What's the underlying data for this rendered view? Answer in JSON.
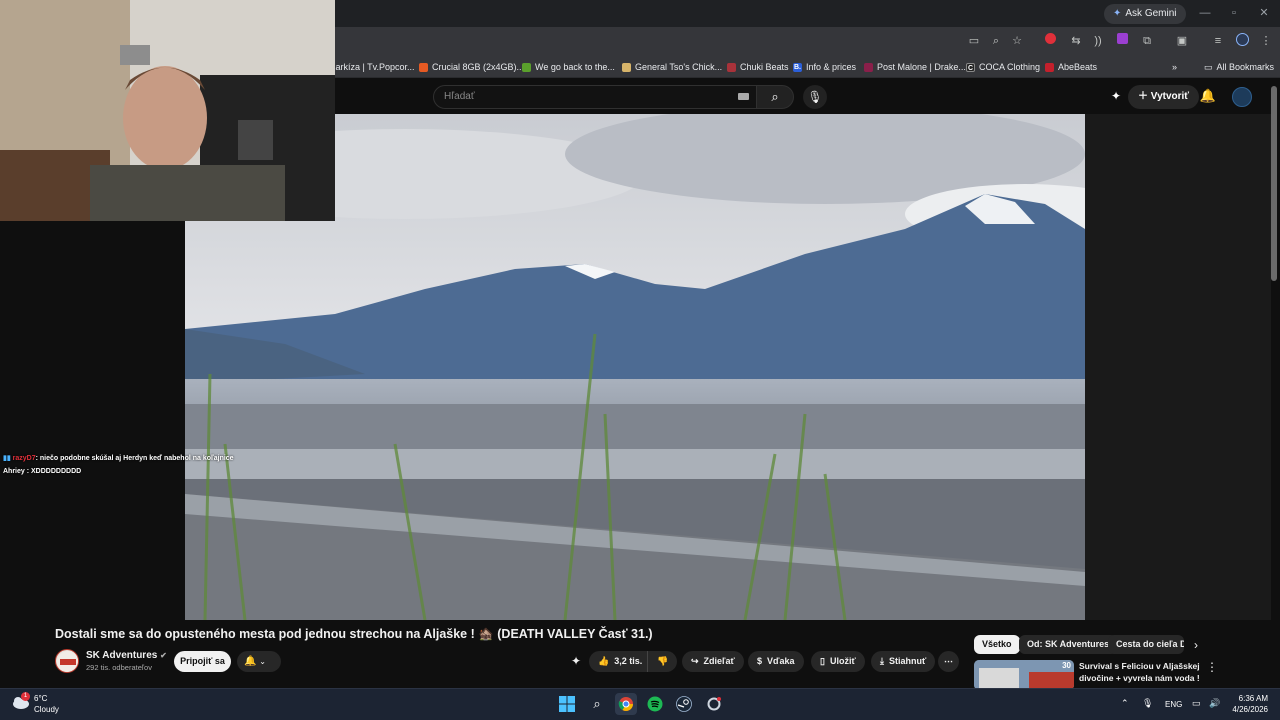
{
  "browser": {
    "ask_gemini": "Ask Gemini",
    "bookmarks": [
      {
        "label": "Markíza | Tv.Popcor...",
        "color": "#c9c9c9"
      },
      {
        "label": "Crucial 8GB (2x4GB)...",
        "color": "#e65a23"
      },
      {
        "label": "We go back to the...",
        "color": "#5aa02c"
      },
      {
        "label": "General Tso's Chick...",
        "color": "#d7b46a"
      },
      {
        "label": "Chuki Beats",
        "color": "#a8323a"
      },
      {
        "label": "Info & prices",
        "color": "#2b5fd9"
      },
      {
        "label": "Post Malone | Drake...",
        "color": "#8a1f4a"
      },
      {
        "label": "COCA Clothing",
        "color": "#222222"
      },
      {
        "label": "AbeBeats",
        "color": "#c4202c"
      }
    ],
    "bm_letters": {
      "info": "B.",
      "coca": "C"
    },
    "all_bookmarks": "All Bookmarks"
  },
  "youtube": {
    "search_placeholder": "Hľadať",
    "create_label": "Vytvoriť"
  },
  "chat": [
    {
      "user": "razyD7",
      "user_color": "#e0303a",
      "text": ": niečo podobne skúšal aj Herdyn keď nabehol na koľajnice"
    },
    {
      "user": "Ahriey",
      "user_color": "#ffffff",
      "text": " : XDDDDDDDDD"
    }
  ],
  "video": {
    "title": "Dostali sme sa do opusteného mesta pod jednou strechou na Aljaške ! 🏚️ (DEATH VALLEY Časť 31.)",
    "channel_name": "SK Adventures",
    "subscribers": "292 tis. odberateľov",
    "join_label": "Pripojiť sa",
    "likes": "3,2 tis.",
    "share_label": "Zdieľať",
    "thanks_label": "Vďaka",
    "save_label": "Uložiť",
    "download_label": "Stiahnuť"
  },
  "recommendations": {
    "chips": [
      "Všetko",
      "Od: SK Adventures",
      "Cesta do cieľa Do"
    ],
    "first": {
      "title": "Survival s Feliciou v Aljašskej divočine + vyvrela nám voda ! ...",
      "badge": "30"
    }
  },
  "taskbar": {
    "weather_temp": "6°C",
    "weather_desc": "Cloudy",
    "weather_badge": "1",
    "lang": "ENG",
    "time": "6:36 AM",
    "date": "4/26/2026"
  },
  "colors": {
    "accent_red": "#ff0000",
    "join_bg": "#f1f1f1",
    "taskbar_bg": "#1c2433"
  }
}
